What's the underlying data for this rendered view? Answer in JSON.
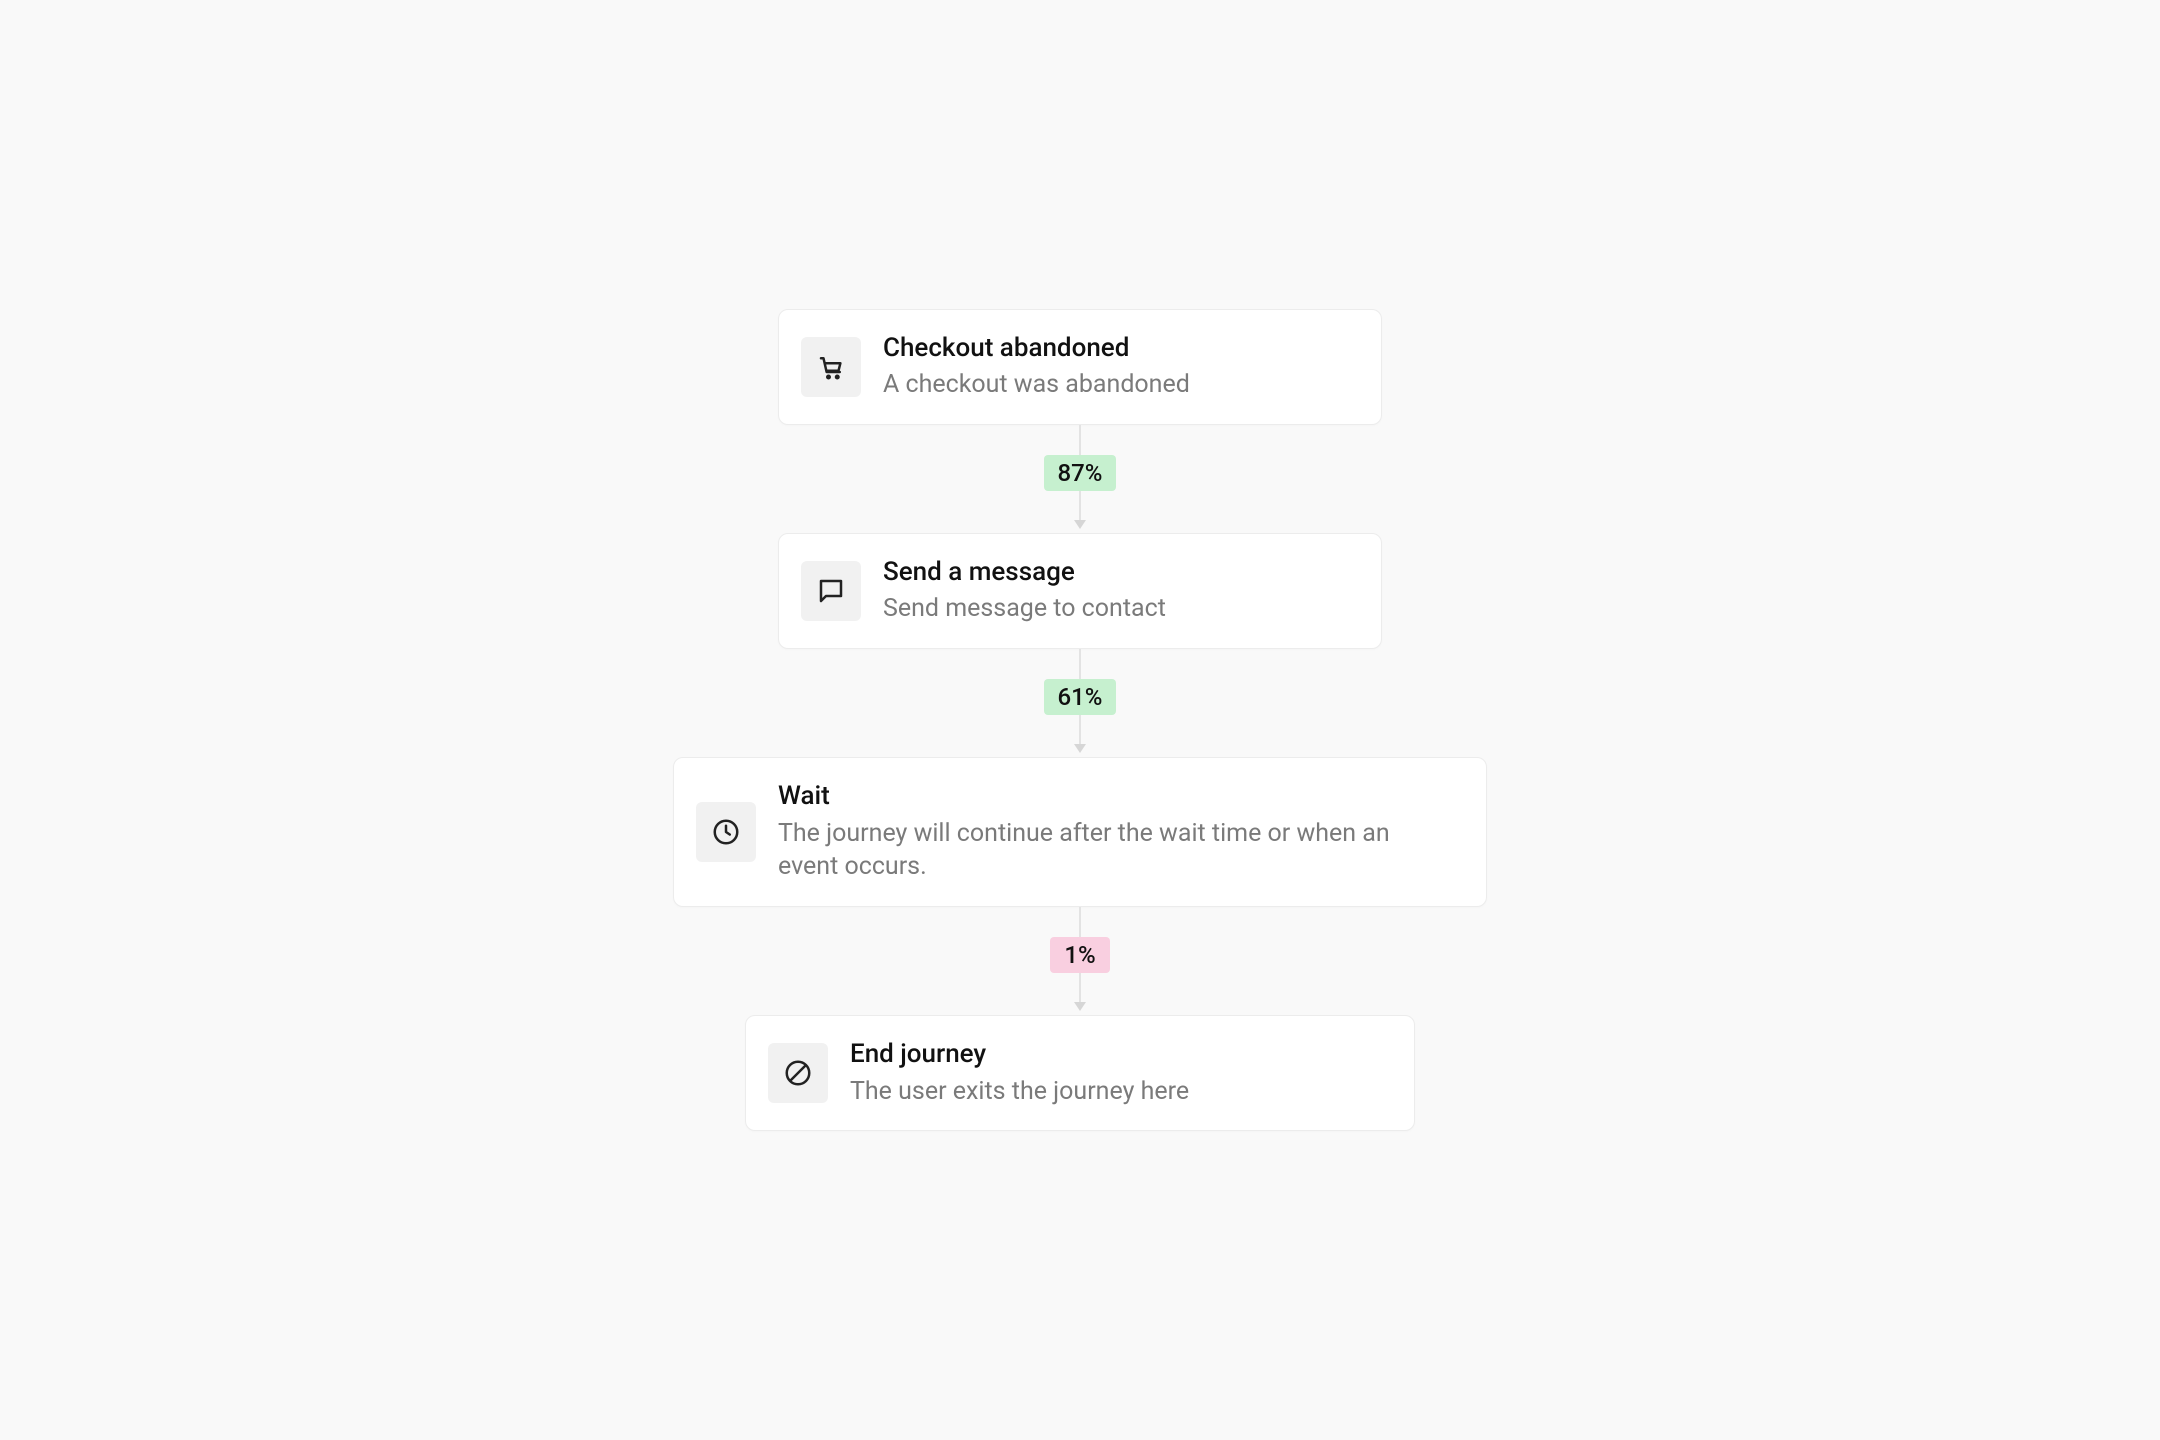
{
  "nodes": [
    {
      "icon": "cart",
      "title": "Checkout abandoned",
      "subtitle": "A checkout was abandoned"
    },
    {
      "icon": "message",
      "title": "Send a message",
      "subtitle": "Send message to contact"
    },
    {
      "icon": "clock",
      "title": "Wait",
      "subtitle": "The journey will continue after the wait time or when an event occurs."
    },
    {
      "icon": "ban",
      "title": "End journey",
      "subtitle": "The user exits the journey here"
    }
  ],
  "connectors": [
    {
      "label": "87%",
      "color": "green"
    },
    {
      "label": "61%",
      "color": "green"
    },
    {
      "label": "1%",
      "color": "pink"
    }
  ]
}
